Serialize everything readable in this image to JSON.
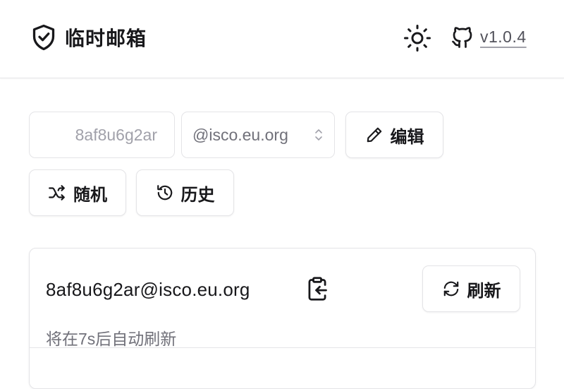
{
  "header": {
    "app_title": "临时邮箱",
    "version": "v1.0.4",
    "icons": {
      "logo": "shield-check-icon",
      "theme": "sun-icon",
      "repo": "github-icon"
    }
  },
  "controls": {
    "username_value": "8af8u6g2ar",
    "domain_value": "@isco.eu.org",
    "edit_label": "编辑",
    "random_label": "随机",
    "history_label": "历史"
  },
  "mailbox": {
    "address": "8af8u6g2ar@isco.eu.org",
    "refresh_label": "刷新",
    "auto_refresh_text": "将在7s后自动刷新"
  },
  "colors": {
    "text": "#18181b",
    "muted": "#71717a",
    "placeholder": "#a1a1aa",
    "border": "#e4e4e7"
  }
}
